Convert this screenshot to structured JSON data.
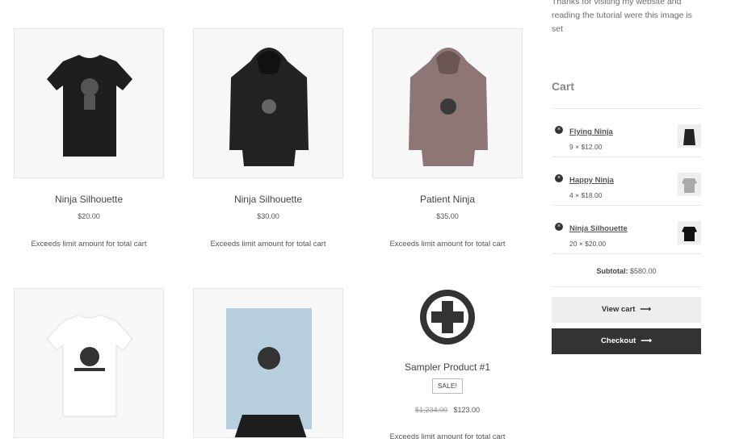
{
  "products": [
    {
      "title": "Ninja Silhouette",
      "price": "$20.00",
      "note": "Exceeds limit amount for total cart"
    },
    {
      "title": "Ninja Silhouette",
      "price": "$30.00",
      "note": "Exceeds limit amount for total cart"
    },
    {
      "title": "Patient Ninja",
      "price": "$35.00",
      "note": "Exceeds limit amount for total cart"
    },
    {
      "title": "Sampler Product #1",
      "badge": "SALE!",
      "old_price": "$1,234.00",
      "price": "$123.00",
      "note": "Exceeds limit amount for total cart"
    }
  ],
  "sidebar": {
    "intro": "Thanks for visiting my website and reading the tutorial were this image is set",
    "cart_heading": "Cart",
    "items": [
      {
        "name": "Flying Ninja",
        "qty": "9 ×",
        "price": "$12.00"
      },
      {
        "name": "Happy Ninja",
        "qty": "4 ×",
        "price": "$18.00"
      },
      {
        "name": "Ninja Silhouette",
        "qty": "20 ×",
        "price": "$20.00"
      }
    ],
    "subtotal_label": "Subtotal:",
    "subtotal_value": "$580.00",
    "view_cart": "View cart",
    "checkout": "Checkout",
    "arrow": "⟶"
  },
  "icons": {
    "remove": "×",
    "add": "plus-circle-icon"
  }
}
